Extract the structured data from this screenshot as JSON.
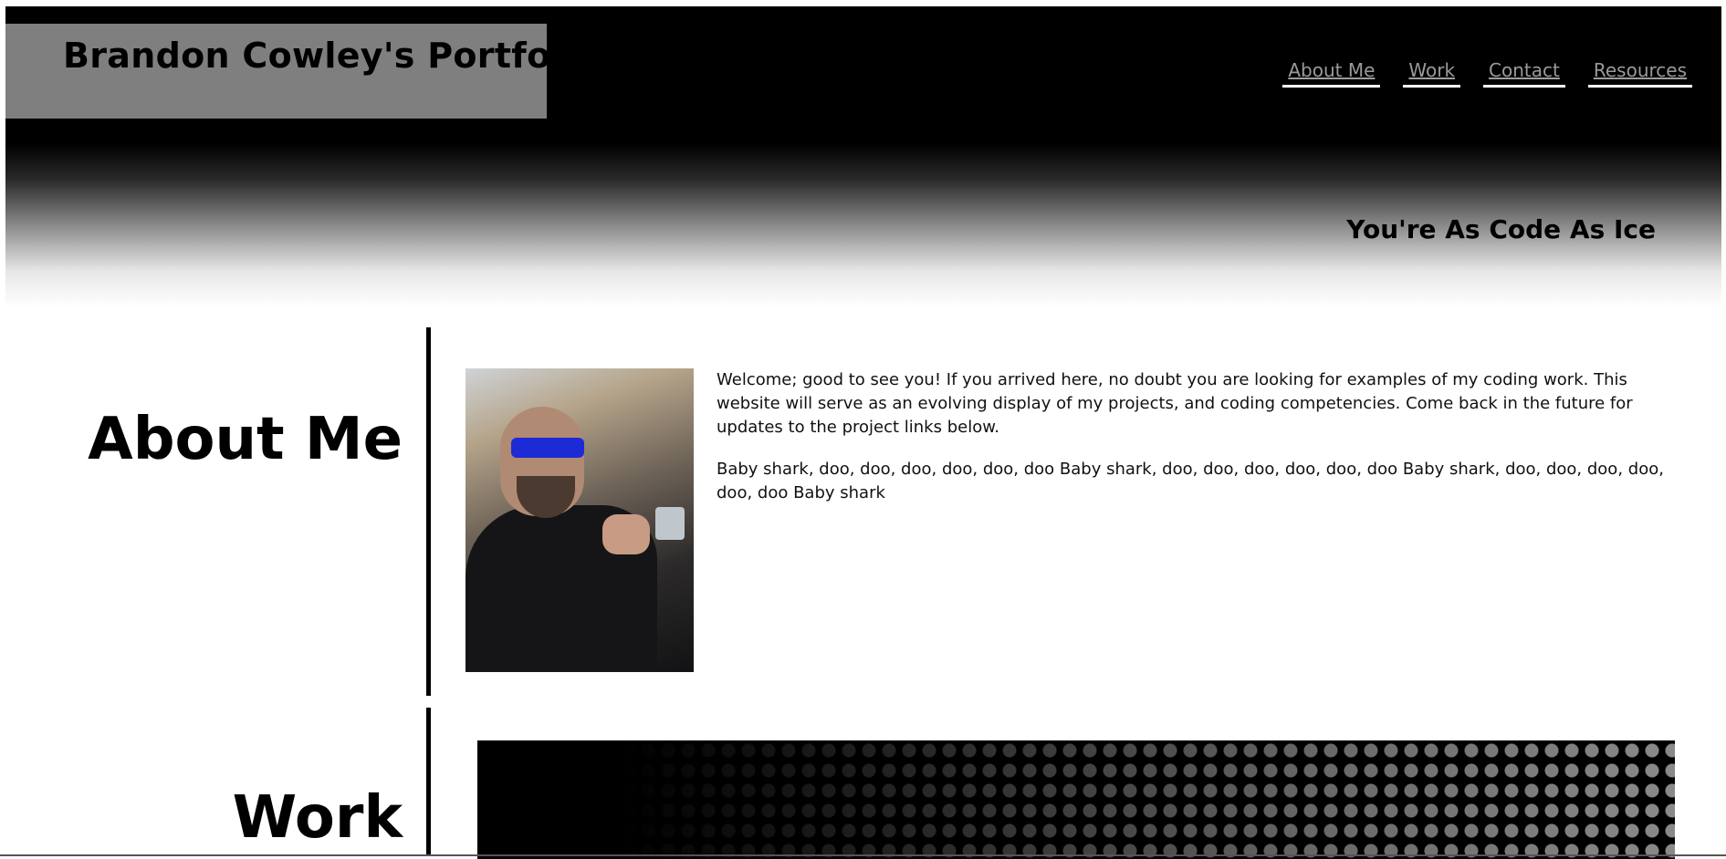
{
  "header": {
    "site_title": "Brandon Cowley's Portfolio",
    "tagline": "You're As Code As Ice",
    "nav": [
      {
        "label": "About Me"
      },
      {
        "label": "Work"
      },
      {
        "label": "Contact"
      },
      {
        "label": "Resources"
      }
    ]
  },
  "about": {
    "heading": "About Me",
    "paragraphs": [
      "Welcome; good to see you! If you arrived here, no doubt you are looking for examples of my coding work. This website will serve as an evolving display of my projects, and coding competencies. Come back in the future for updates to the project links below.",
      "Baby shark, doo, doo, doo, doo, doo, doo Baby shark, doo, doo, doo, doo, doo, doo Baby shark, doo, doo, doo, doo, doo, doo Baby shark"
    ]
  },
  "work": {
    "heading": "Work"
  },
  "colors": {
    "title_box": "#7f7f7f",
    "nav_link": "#9a9a9a",
    "header_bg": "#000000"
  }
}
